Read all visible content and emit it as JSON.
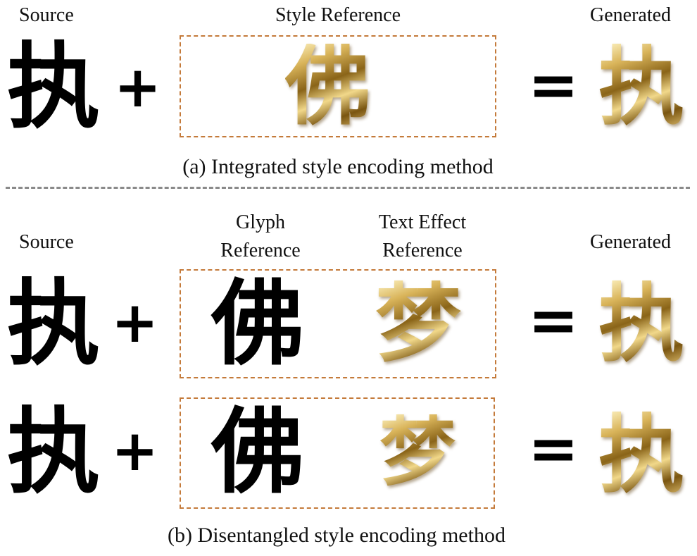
{
  "panel_a": {
    "source_label": "Source",
    "style_reference_label": "Style Reference",
    "generated_label": "Generated",
    "source_char": "执",
    "style_char": "佛",
    "generated_char": "执",
    "plus": "+",
    "equals": "=",
    "caption": "(a) Integrated style encoding method"
  },
  "panel_b": {
    "source_label": "Source",
    "glyph_reference_label_line1": "Glyph",
    "glyph_reference_label_line2": "Reference",
    "text_effect_reference_label_line1": "Text Effect",
    "text_effect_reference_label_line2": "Reference",
    "generated_label": "Generated",
    "rows": [
      {
        "source_char": "执",
        "glyph_char": "佛",
        "effect_char": "梦",
        "generated_char": "执",
        "plus": "+",
        "equals": "="
      },
      {
        "source_char": "执",
        "glyph_char": "佛",
        "effect_char": "梦",
        "generated_char": "执",
        "plus": "+",
        "equals": "="
      }
    ],
    "caption": "(b) Disentangled style encoding method"
  },
  "colors": {
    "box_border": "#c47a3a",
    "separator": "#8a8a8a",
    "gold_effect": "#b08a2e"
  }
}
